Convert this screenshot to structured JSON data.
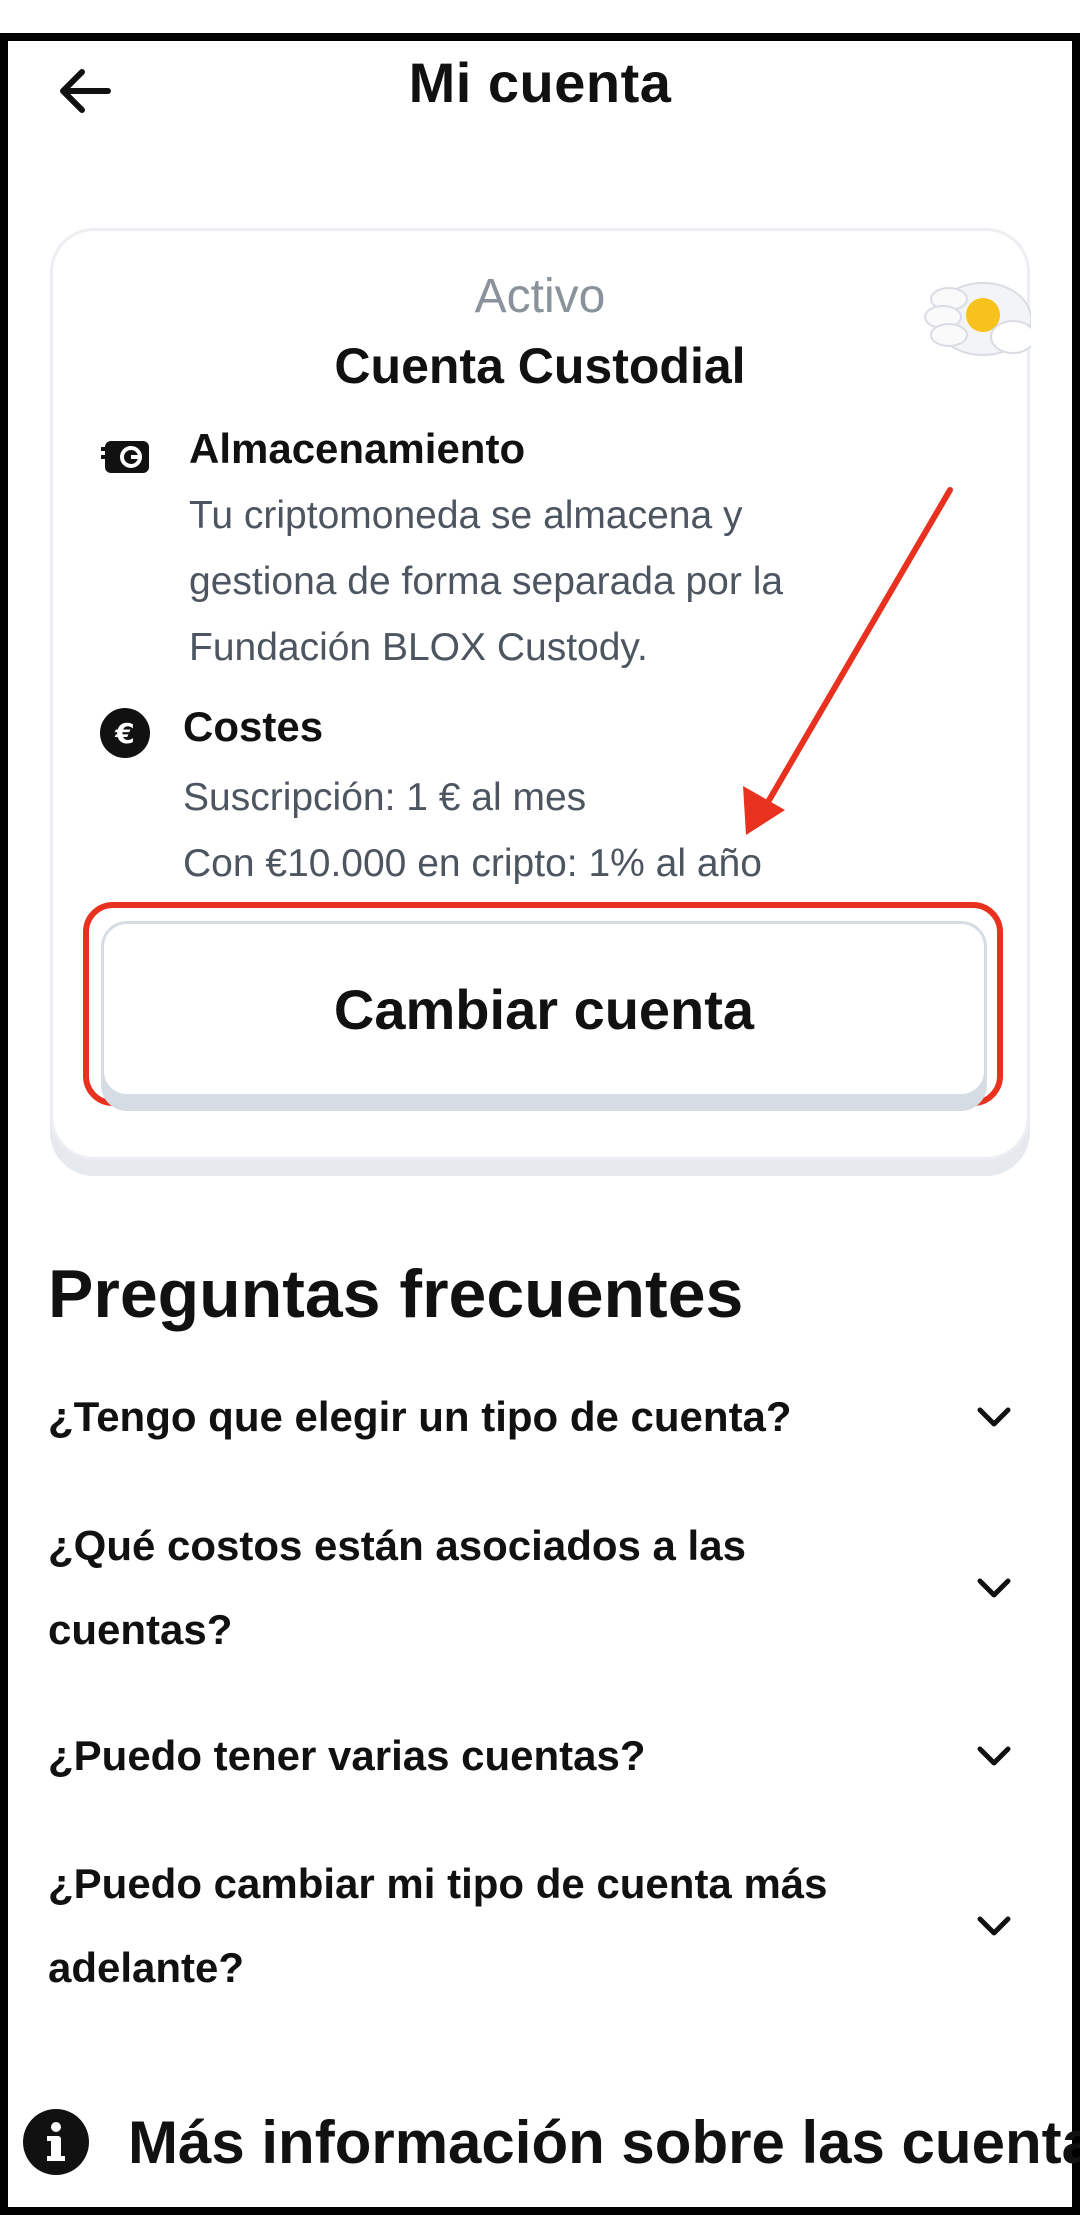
{
  "header": {
    "title": "Mi cuenta",
    "back_icon": "arrow-left-icon"
  },
  "account_card": {
    "status": "Activo",
    "title": "Cuenta Custodial",
    "storage": {
      "title": "Almacenamiento",
      "lines": [
        "Tu criptomoneda se almacena y",
        "gestiona de forma separada por la",
        "Fundación BLOX Custody."
      ]
    },
    "costs": {
      "title": "Costes",
      "lines": [
        "Suscripción: 1 € al mes",
        "Con €10.000 en cripto: 1% al año"
      ]
    },
    "switch_button": "Cambiar cuenta",
    "accent_color": "#e8321f"
  },
  "faq": {
    "title": "Preguntas frecuentes",
    "items": [
      {
        "lines": [
          "¿Tengo que elegir un tipo de cuenta?"
        ]
      },
      {
        "lines": [
          "¿Qué costos están asociados a las",
          "cuentas?"
        ]
      },
      {
        "lines": [
          "¿Puedo tener varias cuentas?"
        ]
      },
      {
        "lines": [
          "¿Puedo cambiar mi tipo de cuenta más",
          "adelante?"
        ]
      }
    ]
  },
  "more_info": {
    "label": "Más información sobre las cuentas",
    "icon": "info-icon"
  }
}
